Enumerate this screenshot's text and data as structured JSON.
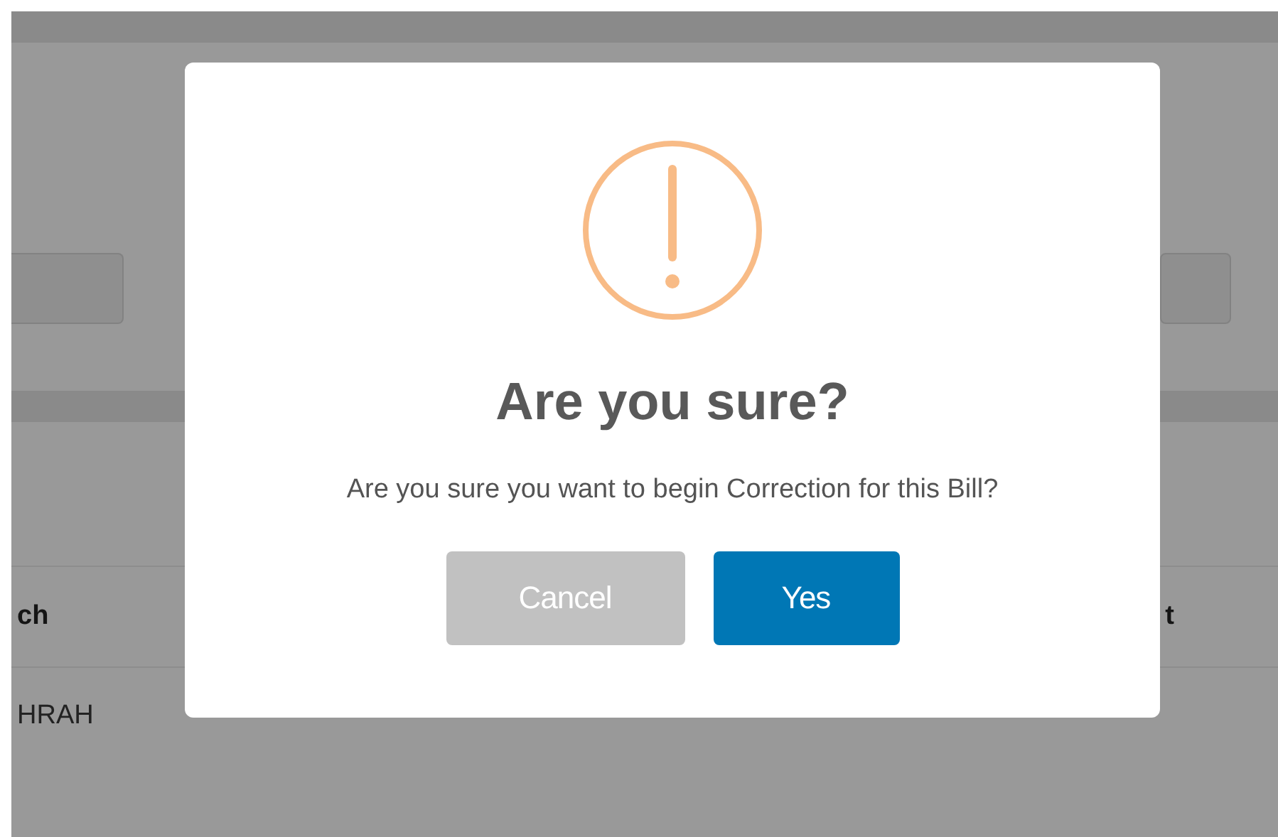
{
  "background": {
    "table": {
      "columns": [
        "ch",
        "t"
      ],
      "rows": [
        [
          "HRAH"
        ]
      ]
    }
  },
  "dialog": {
    "title": "Are you sure?",
    "message": "Are you sure you want to begin Correction for this Bill?",
    "buttons": [
      {
        "label": "Cancel",
        "kind": "cancel"
      },
      {
        "label": "Yes",
        "kind": "confirm"
      }
    ]
  }
}
